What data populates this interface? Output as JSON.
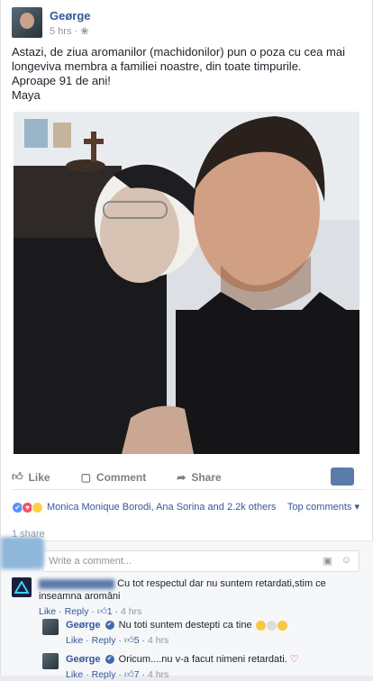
{
  "post": {
    "author": "Geørge",
    "time": "5 hrs",
    "text_lines": [
      "Astazi, de ziua aromanilor (machidonilor) pun o poza cu cea mai",
      "longeviva membra a familiei noastre, din toate timpurile.",
      "Aproape 91 de ani!",
      "Maya"
    ]
  },
  "actions": {
    "like": "Like",
    "comment": "Comment",
    "share": "Share"
  },
  "reactions": {
    "names": "Monica Monique Borodi, Ana Sorina and 2.2k others",
    "top_comments": "Top comments"
  },
  "share_count": "1 share",
  "composer": {
    "placeholder": "Write a comment..."
  },
  "comments": [
    {
      "text": "Cu tot respectul dar nu suntem retardati,stim ce inseamna aromâni",
      "like": "Like",
      "reply": "Reply",
      "likes": "1",
      "time": "4 hrs"
    },
    {
      "author": "Geørge",
      "text": "Nu toti suntem destepti ca tine",
      "like": "Like",
      "reply": "Reply",
      "likes": "5",
      "time": "4 hrs"
    },
    {
      "author": "Geørge",
      "text": "Oricum....nu v-a facut nimeni retardati.",
      "like": "Like",
      "reply": "Reply",
      "likes": "7",
      "time": "4 hrs"
    }
  ],
  "colors": {
    "link": "#365899",
    "muted": "#90949c",
    "like_blue": "#5890ff"
  }
}
